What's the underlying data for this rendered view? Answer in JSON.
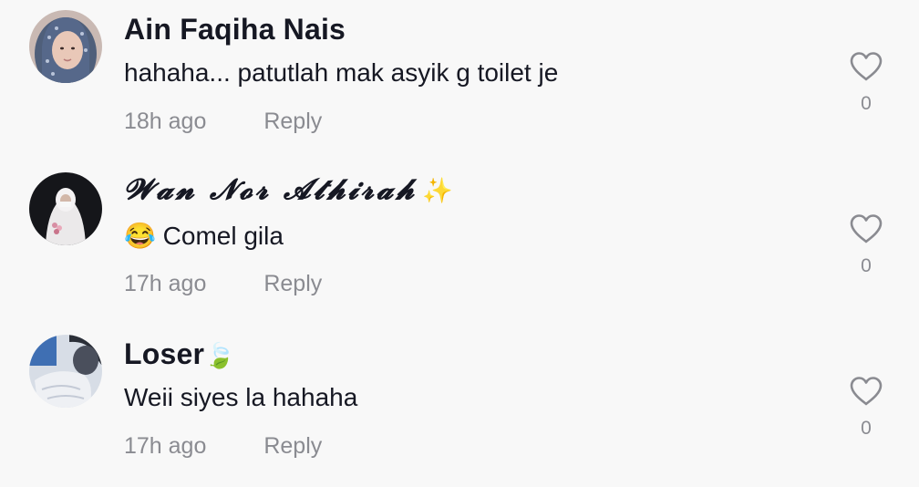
{
  "comments": [
    {
      "username": "Ain Faqiha Nais",
      "name_emoji": "",
      "text": "hahaha... patutlah mak asyik g toilet je",
      "text_emoji": "",
      "time": "18h ago",
      "reply_label": "Reply",
      "like_count": "0",
      "avatar": "avatar-hijab-woman"
    },
    {
      "username": "𝓦𝓪𝓷 𝓝𝓸𝓻 𝓐𝓽𝓱𝓲𝓻𝓪𝓱",
      "name_emoji": "✨",
      "text": "Comel gila",
      "text_emoji": "😂",
      "time": "17h ago",
      "reply_label": "Reply",
      "like_count": "0",
      "avatar": "avatar-bride-white"
    },
    {
      "username": "Loser",
      "name_emoji": "🍃",
      "text": "Weii siyes la hahaha",
      "text_emoji": "",
      "time": "17h ago",
      "reply_label": "Reply",
      "like_count": "0",
      "avatar": "avatar-blurred-photo"
    }
  ],
  "icons": {
    "like": "heart-outline-icon"
  },
  "colors": {
    "background": "#f8f8f8",
    "primary_text": "#161823",
    "secondary_text": "#8a8b91"
  }
}
